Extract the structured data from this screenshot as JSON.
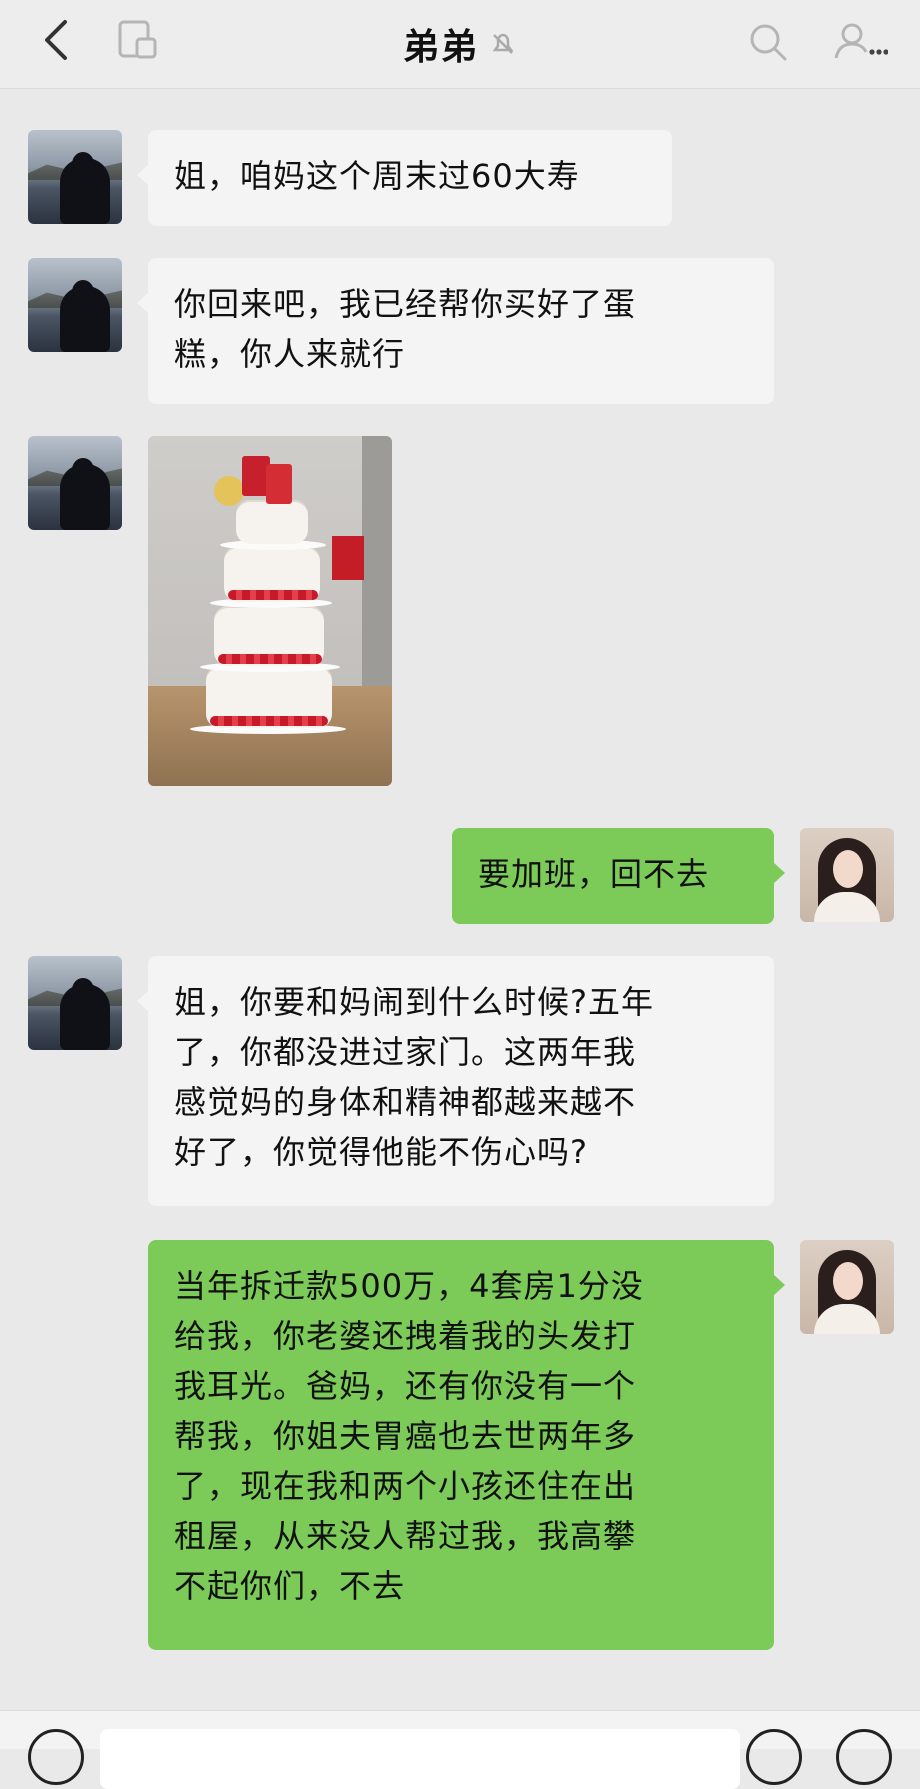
{
  "header": {
    "title": "弟弟",
    "back_icon": "chevron-left-icon",
    "mini_program_icon": "floating-window-icon",
    "mute_icon": "bell-off-icon",
    "search_icon": "search-icon",
    "more_icon": "person-more-icon"
  },
  "messages": [
    {
      "side": "in",
      "sender": "brother",
      "text": "姐，咱妈这个周末过60大寿"
    },
    {
      "side": "in",
      "sender": "brother",
      "text": "你回来吧，我已经帮你买好了蛋\n糕，你人来就行"
    },
    {
      "side": "in",
      "sender": "brother",
      "type": "image",
      "image": "cake-photo"
    },
    {
      "side": "out",
      "sender": "me",
      "text": "要加班，回不去"
    },
    {
      "side": "in",
      "sender": "brother",
      "text": "姐，你要和妈闹到什么时候?五年\n了，你都没进过家门。这两年我\n感觉妈的身体和精神都越来越不\n好了，你觉得他能不伤心吗?"
    },
    {
      "side": "out",
      "sender": "me",
      "text": "当年拆迁款500万，4套房1分没\n给我，你老婆还拽着我的头发打\n我耳光。爸妈，还有你没有一个\n帮我，你姐夫胃癌也去世两年多\n了，现在我和两个小孩还住在出\n租屋，从来没人帮过我，我高攀\n不起你们，不去"
    }
  ],
  "colors": {
    "background": "#e9e9e9",
    "incoming_bubble": "#f4f4f4",
    "outgoing_bubble": "#7ccb58"
  },
  "inputbar": {
    "voice_icon": "voice-icon",
    "emoji_icon": "emoji-icon",
    "plus_icon": "plus-icon"
  }
}
